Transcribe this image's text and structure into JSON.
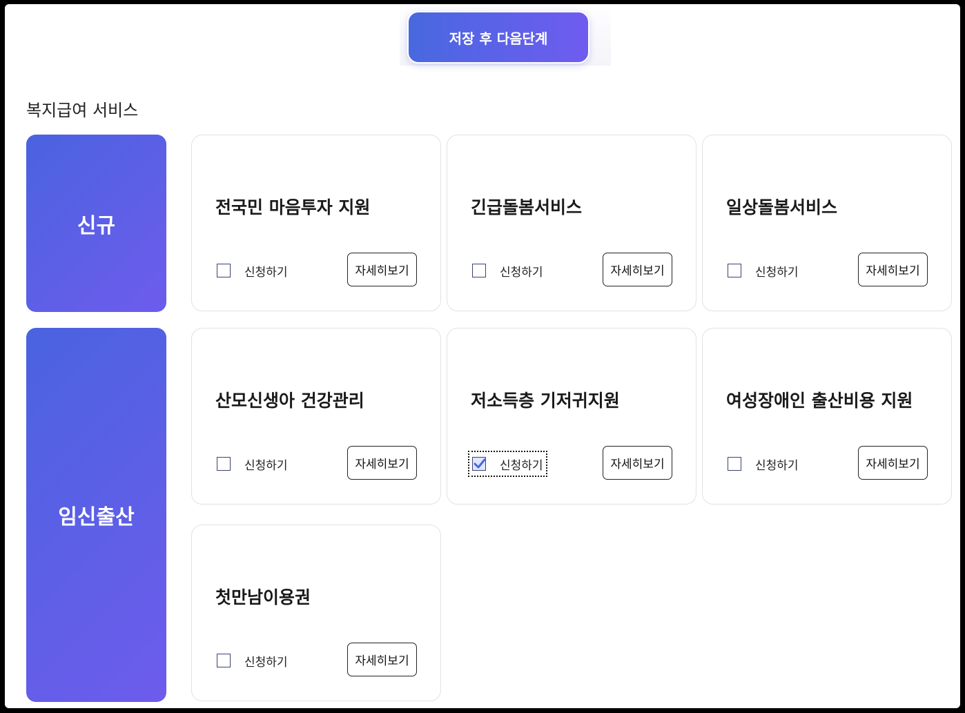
{
  "toolbar": {
    "save_next_label": "저장 후 다음단계"
  },
  "section": {
    "title": "복지급여 서비스"
  },
  "categories": [
    {
      "label": "신규"
    },
    {
      "label": "임신출산"
    }
  ],
  "cards": [
    {
      "title": "전국민 마음투자 지원",
      "apply_label": "신청하기",
      "detail_label": "자세히보기",
      "checked": false
    },
    {
      "title": "긴급돌봄서비스",
      "apply_label": "신청하기",
      "detail_label": "자세히보기",
      "checked": false
    },
    {
      "title": "일상돌봄서비스",
      "apply_label": "신청하기",
      "detail_label": "자세히보기",
      "checked": false
    },
    {
      "title": "산모신생아 건강관리",
      "apply_label": "신청하기",
      "detail_label": "자세히보기",
      "checked": false
    },
    {
      "title": "저소득층 기저귀지원",
      "apply_label": "신청하기",
      "detail_label": "자세히보기",
      "checked": true
    },
    {
      "title": "여성장애인 출산비용 지원",
      "apply_label": "신청하기",
      "detail_label": "자세히보기",
      "checked": false
    },
    {
      "title": "첫만남이용권",
      "apply_label": "신청하기",
      "detail_label": "자세히보기",
      "checked": false
    }
  ],
  "colors": {
    "accent_start": "#4868df",
    "accent_end": "#6f5cf0",
    "check": "#4a64e0"
  }
}
